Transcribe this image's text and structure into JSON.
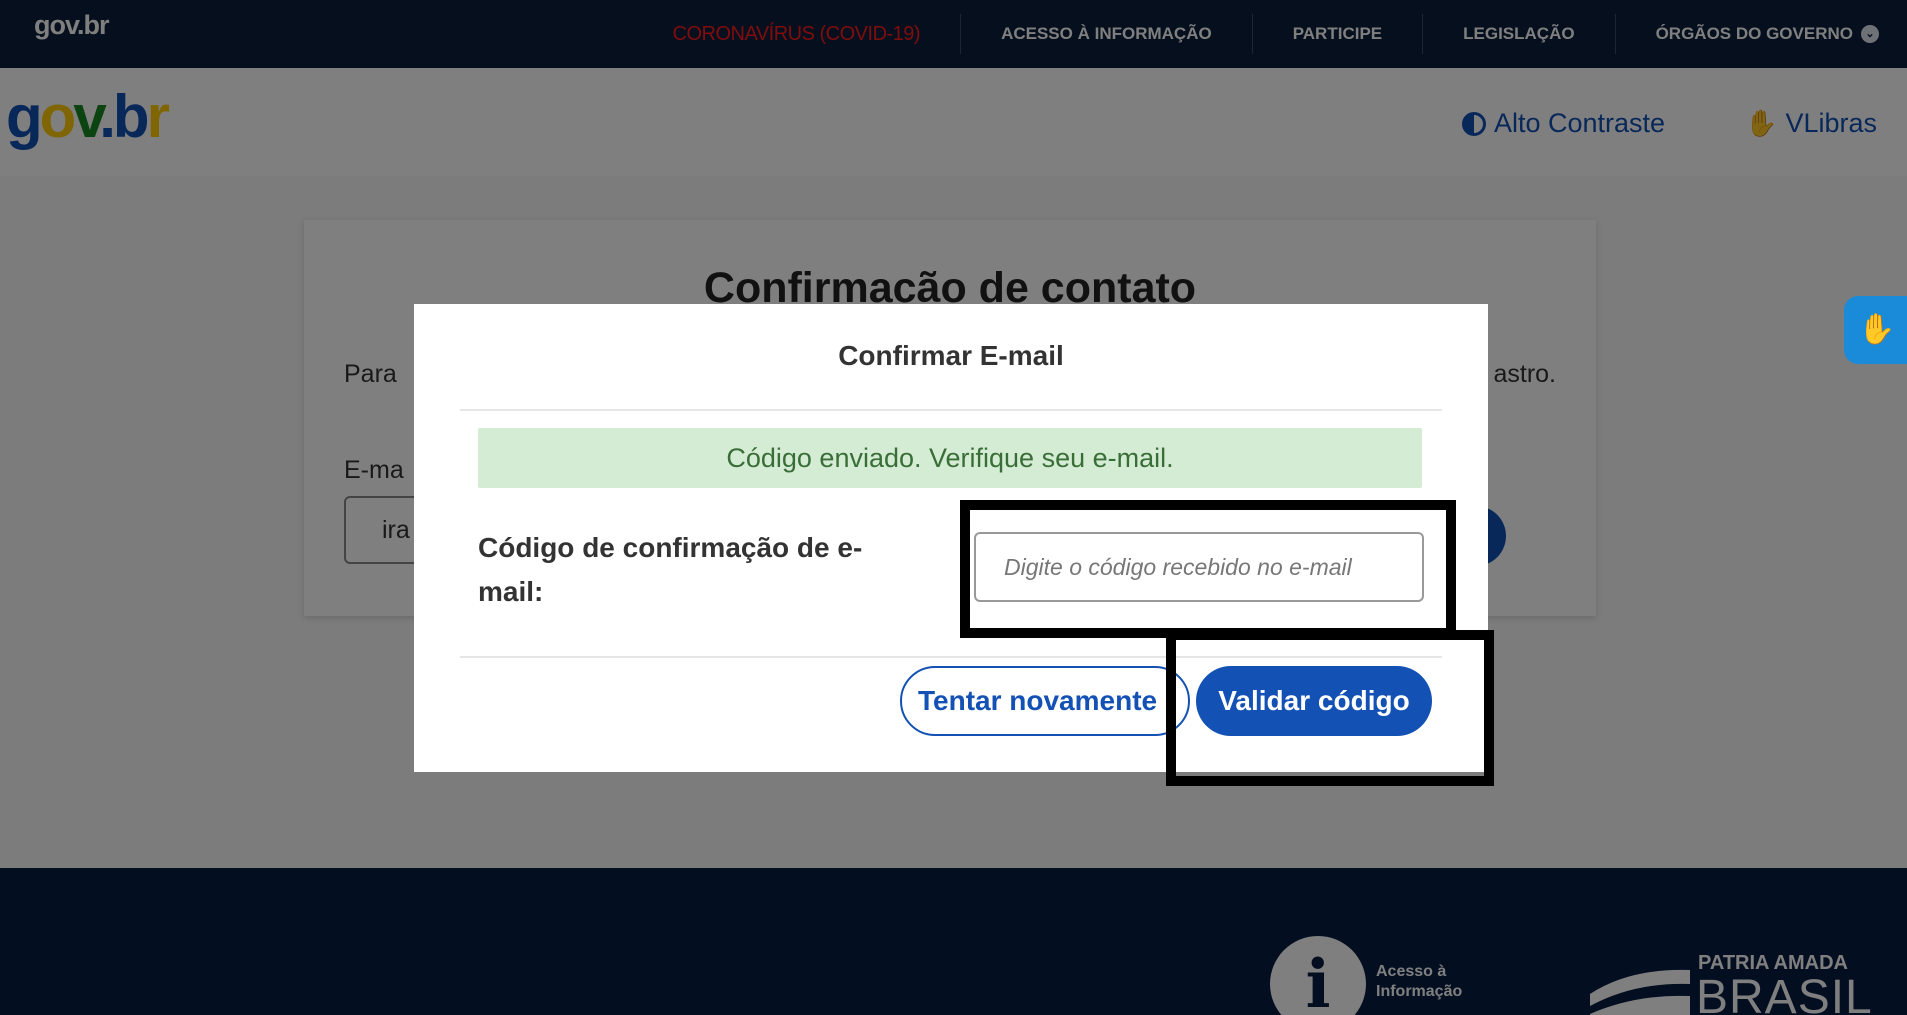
{
  "govbar": {
    "logo": "gov.br",
    "links": [
      "CORONAVÍRUS (COVID-19)",
      "ACESSO À INFORMAÇÃO",
      "PARTICIPE",
      "LEGISLAÇÃO",
      "ÓRGÃOS DO GOVERNO"
    ]
  },
  "header": {
    "logo": {
      "g": "g",
      "o": "o",
      "v": "v",
      "dot": ".",
      "b": "b",
      "r": "r"
    },
    "contrast_label": "Alto Contraste",
    "vlibras_label": "VLibras"
  },
  "card": {
    "title": "Confirmacão de contato",
    "text_left": "Para",
    "text_right": "astro.",
    "email_label": "E-ma",
    "email_value": "ira"
  },
  "modal": {
    "title": "Confirmar E-mail",
    "alert": "Código enviado. Verifique seu e-mail.",
    "field_label": "Código de confirmação de e-mail:",
    "input_placeholder": "Digite o código recebido no e-mail",
    "retry_label": "Tentar novamente",
    "validate_label": "Validar código"
  },
  "footer": {
    "info_icon": "i",
    "info_line1": "Acesso à",
    "info_line2": "Informação",
    "brasil_line1": "PATRIA AMADA",
    "brasil_line2": "BRASIL"
  },
  "colors": {
    "primary": "#1351b4",
    "govbar_bg": "#0b1f3a",
    "footer_bg": "#071d41",
    "covid_red": "#ff1a1a",
    "alert_bg": "#d4ecd3"
  }
}
